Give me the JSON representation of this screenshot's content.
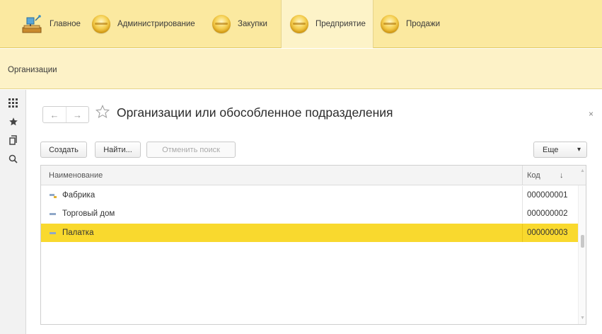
{
  "sections": [
    {
      "label": "Главное",
      "icon": "home-desk-icon",
      "active": false
    },
    {
      "label": "Администрирование",
      "icon": "section-ball-icon",
      "active": false
    },
    {
      "label": "Закупки",
      "icon": "section-ball-icon",
      "active": false
    },
    {
      "label": "Предприятие",
      "icon": "section-ball-icon",
      "active": true
    },
    {
      "label": "Продажи",
      "icon": "section-ball-icon",
      "active": false
    }
  ],
  "open_windows": [
    "Организации"
  ],
  "left_panel": [
    "apps-grid-icon",
    "star-icon",
    "history-icon",
    "search-icon"
  ],
  "form": {
    "title": "Организации или обособленное подразделения",
    "close": "×",
    "nav_back": "←",
    "nav_forward": "→"
  },
  "toolbar": {
    "create": "Создать",
    "find": "Найти...",
    "cancel_search": "Отменить поиск",
    "more": "Еще",
    "more_arrow": "▾"
  },
  "table": {
    "columns": {
      "name": "Наименование",
      "code": "Код",
      "sort": "↓"
    },
    "rows": [
      {
        "name": "Фабрика",
        "code": "000000001",
        "selected": false,
        "icon": "group-item-icon"
      },
      {
        "name": "Торговый дом",
        "code": "000000002",
        "selected": false,
        "icon": "item-icon"
      },
      {
        "name": "Палатка",
        "code": "000000003",
        "selected": true,
        "icon": "item-icon"
      }
    ]
  },
  "colors": {
    "section_bar": "#fbe9a0",
    "selected_row": "#f9d92e"
  }
}
